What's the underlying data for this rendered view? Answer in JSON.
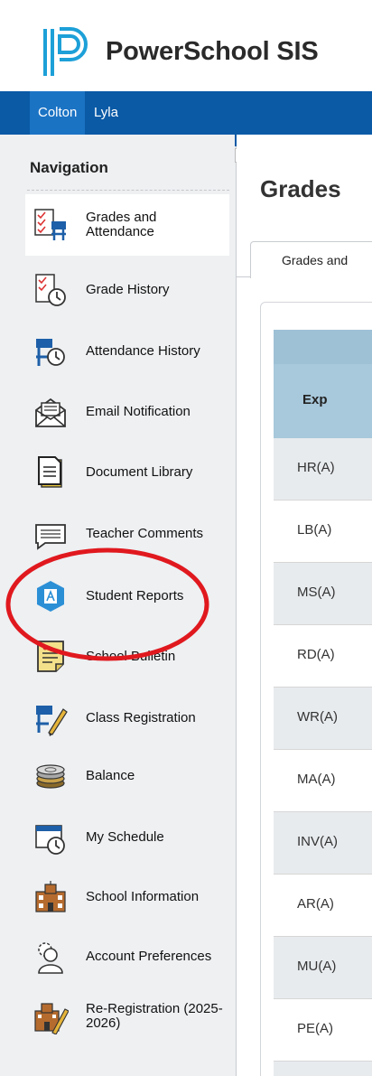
{
  "app": {
    "name": "PowerSchool SIS",
    "logo_icon": "powerschool-logo-icon"
  },
  "students": [
    {
      "name": "Colton",
      "active": true
    },
    {
      "name": "Lyla",
      "active": false
    }
  ],
  "sidebar": {
    "heading": "Navigation",
    "items": [
      {
        "label": "Grades and Attendance",
        "icon": "grades-attendance-icon",
        "active": true
      },
      {
        "label": "Grade History",
        "icon": "grade-history-icon"
      },
      {
        "label": "Attendance History",
        "icon": "attendance-history-icon"
      },
      {
        "label": "Email Notification",
        "icon": "email-notification-icon"
      },
      {
        "label": "Document Library",
        "icon": "document-library-icon"
      },
      {
        "label": "Teacher Comments",
        "icon": "teacher-comments-icon"
      },
      {
        "label": "Student Reports",
        "icon": "student-reports-icon",
        "highlighted": true
      },
      {
        "label": "School Bulletin",
        "icon": "school-bulletin-icon"
      },
      {
        "label": "Class Registration",
        "icon": "class-registration-icon"
      },
      {
        "label": "Balance",
        "icon": "balance-icon"
      },
      {
        "label": "My Schedule",
        "icon": "my-schedule-icon"
      },
      {
        "label": "School Information",
        "icon": "school-information-icon"
      },
      {
        "label": "Account Preferences",
        "icon": "account-preferences-icon"
      },
      {
        "label": "Re-Registration (2025-2026)",
        "icon": "re-registration-icon"
      }
    ]
  },
  "main": {
    "title": "Grades",
    "tab": "Grades and",
    "table": {
      "header": "Exp",
      "rows": [
        "HR(A)",
        "LB(A)",
        "MS(A)",
        "RD(A)",
        "WR(A)",
        "MA(A)",
        "INV(A)",
        "AR(A)",
        "MU(A)",
        "PE(A)"
      ]
    }
  },
  "colors": {
    "student_bar": "#0a5aa6",
    "table_header": "#a8c8db",
    "annotation_circle": "#e0191f"
  }
}
